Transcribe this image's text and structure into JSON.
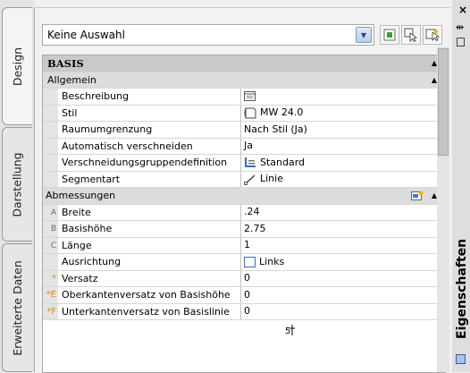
{
  "tabs": [
    {
      "label": "Design"
    },
    {
      "label": "Darstellung"
    },
    {
      "label": "Erweiterte Daten"
    }
  ],
  "toolbar": {
    "selection_value": "Keine Auswahl"
  },
  "groups": {
    "basis": "BASIS",
    "allgemein": "Allgemein",
    "abmessungen": "Abmessungen"
  },
  "allgemein_rows": [
    {
      "name": "Beschreibung",
      "value": "",
      "icon": "description-icon"
    },
    {
      "name": "Stil",
      "value": "MW 24.0",
      "icon": "style-icon"
    },
    {
      "name": "Raumumgrenzung",
      "value": "Nach Stil (Ja)",
      "icon": ""
    },
    {
      "name": "Automatisch verschneiden",
      "value": "Ja",
      "icon": ""
    },
    {
      "name": "Verschneidungsgruppendefinition",
      "value": "Standard",
      "icon": "group-definition-icon"
    },
    {
      "name": "Segmentart",
      "value": "Linie",
      "icon": "line-segment-icon"
    }
  ],
  "abmessungen_rows": [
    {
      "gutter": "A",
      "name": "Breite",
      "value": ".24"
    },
    {
      "gutter": "B",
      "name": "Basishöhe",
      "value": "2.75"
    },
    {
      "gutter": "C",
      "name": "Länge",
      "value": "1"
    },
    {
      "gutter": "",
      "name": "Ausrichtung",
      "value": "Links"
    },
    {
      "gutter": "*",
      "name": "Versatz",
      "value": "0"
    },
    {
      "gutter": "*E",
      "name": "Oberkantenversatz von Basishöhe",
      "value": "0"
    },
    {
      "gutter": "*F",
      "name": "Unterkantenversatz von Basislinie",
      "value": "0"
    }
  ],
  "palette": {
    "title": "Eigenschaften"
  }
}
